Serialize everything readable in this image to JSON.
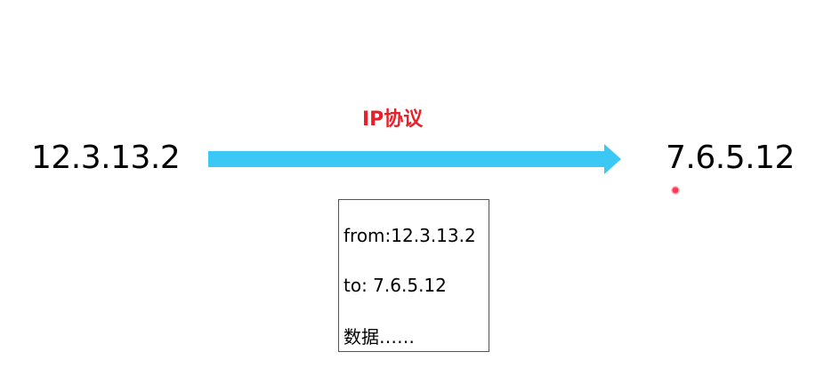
{
  "source_ip": "12.3.13.2",
  "dest_ip": "7.6.5.12",
  "protocol_label": "IP协议",
  "packet": {
    "from_line": "from:12.3.13.2",
    "to_line": "to: 7.6.5.12",
    "data_line": "数据……"
  },
  "colors": {
    "arrow": "#3cc8f5",
    "protocol_label": "#e8202a",
    "cursor": "#ff3b5a"
  },
  "icons": {
    "cursor": "pointer-dot-icon",
    "arrow": "right-arrow-icon"
  }
}
